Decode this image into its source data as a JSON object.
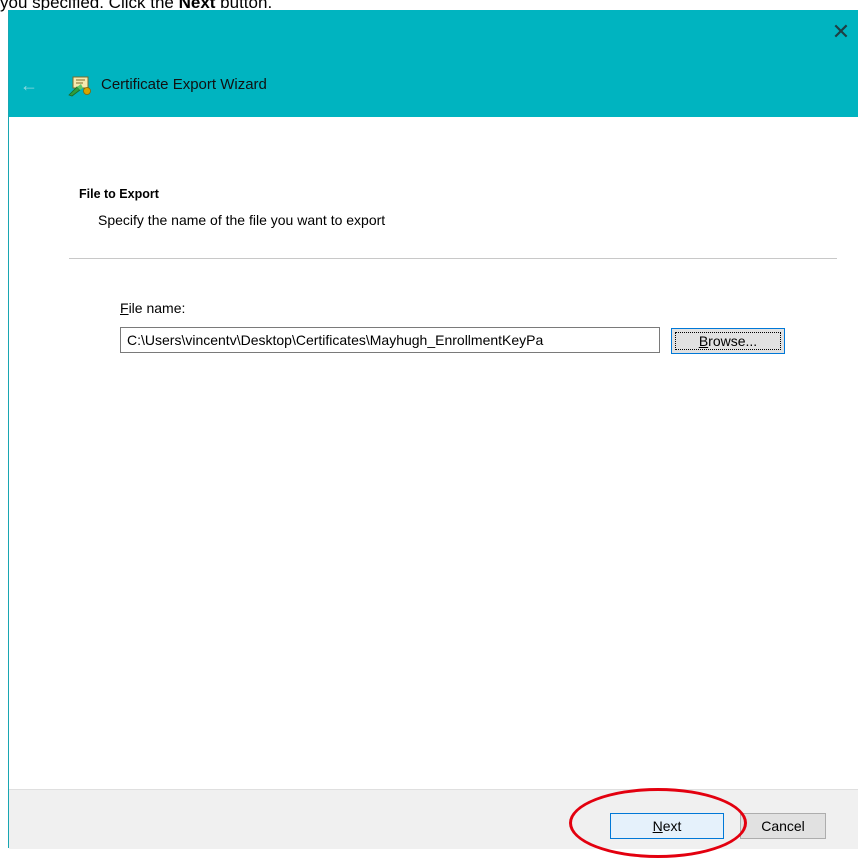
{
  "instruction": {
    "before": "you specified. Click the ",
    "bold": "Next",
    "after": " button."
  },
  "dialog": {
    "title": "Certificate Export Wizard",
    "close_glyph": "✕",
    "back_glyph": "←"
  },
  "section": {
    "title": "File to Export",
    "description": "Specify the name of the file you want to export"
  },
  "file": {
    "label_accel": "F",
    "label_rest": "ile name:",
    "value": "C:\\Users\\vincentv\\Desktop\\Certificates\\Mayhugh_EnrollmentKeyPa"
  },
  "buttons": {
    "browse_accel": "B",
    "browse_rest": "rowse...",
    "next_accel": "N",
    "next_rest": "ext",
    "cancel": "Cancel"
  },
  "colors": {
    "titlebar": "#00b4c0",
    "accent": "#0078d7",
    "highlight": "#e3000f"
  },
  "icons": {
    "wizard": "certificate-icon",
    "close": "close-icon",
    "back": "back-arrow-icon"
  }
}
